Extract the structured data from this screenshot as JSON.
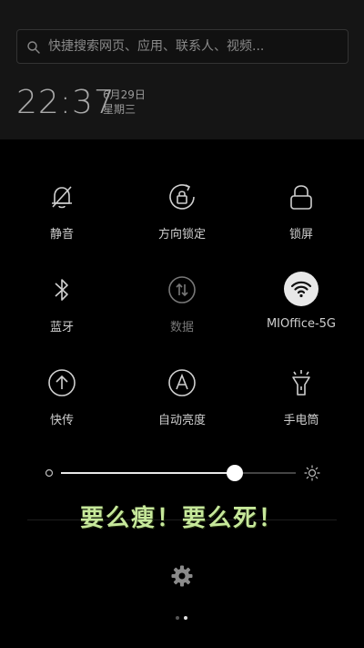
{
  "search": {
    "placeholder": "快捷搜索网页、应用、联系人、视频..."
  },
  "clock": {
    "time": "22:37",
    "date": "6月29日",
    "weekday": "星期三"
  },
  "toggles": [
    {
      "label": "静音",
      "icon": "bell-off-icon",
      "active": false
    },
    {
      "label": "方向锁定",
      "icon": "rotation-lock-icon",
      "active": false
    },
    {
      "label": "锁屏",
      "icon": "lock-icon",
      "active": false
    },
    {
      "label": "蓝牙",
      "icon": "bluetooth-icon",
      "active": false
    },
    {
      "label": "数据",
      "icon": "mobile-data-icon",
      "active": false
    },
    {
      "label": "MIOffice-5G",
      "icon": "wifi-icon",
      "active": true
    },
    {
      "label": "快传",
      "icon": "upload-icon",
      "active": false
    },
    {
      "label": "自动亮度",
      "icon": "auto-brightness-icon",
      "active": false
    },
    {
      "label": "手电筒",
      "icon": "flashlight-icon",
      "active": false
    }
  ],
  "brightness": {
    "level": 0.74
  },
  "overlay": {
    "text": "要么瘦！要么死！"
  },
  "pager": {
    "pages": 2,
    "current": 2
  },
  "colors": {
    "accent": "#4cd137",
    "overlay_text": "#c6e89a",
    "panel": "#151515"
  }
}
